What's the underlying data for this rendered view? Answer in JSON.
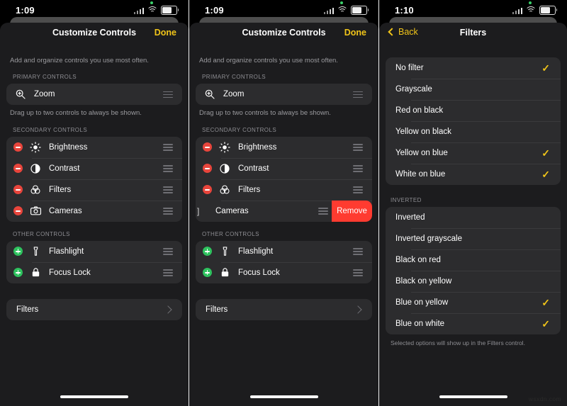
{
  "watermark": "wsxdn.com",
  "panels": [
    {
      "id": "customize-controls",
      "status": {
        "time": "1:09"
      },
      "nav": {
        "title": "Customize Controls",
        "done": "Done"
      },
      "hint_top": "Add and organize controls you use most often.",
      "hint_primary": "Drag up to two controls to always be shown.",
      "sections": [
        {
          "header": "PRIMARY CONTROLS",
          "rows": [
            {
              "label": "Zoom",
              "icon": "zoom-in-icon",
              "badge": "none",
              "handle": true
            }
          ]
        },
        {
          "header": "SECONDARY CONTROLS",
          "rows": [
            {
              "label": "Brightness",
              "icon": "brightness-icon",
              "badge": "minus",
              "handle": true
            },
            {
              "label": "Contrast",
              "icon": "contrast-icon",
              "badge": "minus",
              "handle": true
            },
            {
              "label": "Filters",
              "icon": "filters-icon",
              "badge": "minus",
              "handle": true
            },
            {
              "label": "Cameras",
              "icon": "camera-icon",
              "badge": "minus",
              "handle": true
            }
          ]
        },
        {
          "header": "OTHER CONTROLS",
          "rows": [
            {
              "label": "Flashlight",
              "icon": "flashlight-icon",
              "badge": "plus",
              "handle": true
            },
            {
              "label": "Focus Lock",
              "icon": "lock-icon",
              "badge": "plus",
              "handle": true
            }
          ]
        }
      ],
      "filters_row": {
        "label": "Filters",
        "disclosure": "chevron-right-icon"
      }
    },
    {
      "id": "customize-controls-swiped",
      "status": {
        "time": "1:09"
      },
      "nav": {
        "title": "Customize Controls",
        "done": "Done"
      },
      "hint_top": "Add and organize controls you use most often.",
      "hint_primary": "Drag up to two controls to always be shown.",
      "sections": [
        {
          "header": "PRIMARY CONTROLS",
          "rows": [
            {
              "label": "Zoom",
              "icon": "zoom-in-icon",
              "badge": "none",
              "handle": true
            }
          ]
        },
        {
          "header": "SECONDARY CONTROLS",
          "rows": [
            {
              "label": "Brightness",
              "icon": "brightness-icon",
              "badge": "minus",
              "handle": true
            },
            {
              "label": "Contrast",
              "icon": "contrast-icon",
              "badge": "minus",
              "handle": true
            },
            {
              "label": "Filters",
              "icon": "filters-icon",
              "badge": "minus",
              "handle": true
            },
            {
              "label": "Cameras",
              "icon": "camera-icon",
              "badge": "swiped",
              "handle": true,
              "swiped": true,
              "remove_label": "Remove"
            }
          ]
        },
        {
          "header": "OTHER CONTROLS",
          "rows": [
            {
              "label": "Flashlight",
              "icon": "flashlight-icon",
              "badge": "plus",
              "handle": true
            },
            {
              "label": "Focus Lock",
              "icon": "lock-icon",
              "badge": "plus",
              "handle": true
            }
          ]
        }
      ],
      "filters_row": {
        "label": "Filters",
        "disclosure": "chevron-right-icon"
      }
    },
    {
      "id": "filters",
      "status": {
        "time": "1:10"
      },
      "nav": {
        "back": "Back",
        "title": "Filters"
      },
      "groups": [
        {
          "header": "",
          "items": [
            {
              "label": "No filter",
              "checked": true
            },
            {
              "label": "Grayscale",
              "checked": false
            },
            {
              "label": "Red on black",
              "checked": false
            },
            {
              "label": "Yellow on black",
              "checked": false
            },
            {
              "label": "Yellow on blue",
              "checked": true
            },
            {
              "label": "White on blue",
              "checked": true
            }
          ]
        },
        {
          "header": "INVERTED",
          "items": [
            {
              "label": "Inverted",
              "checked": false
            },
            {
              "label": "Inverted grayscale",
              "checked": false
            },
            {
              "label": "Black on red",
              "checked": false
            },
            {
              "label": "Black on yellow",
              "checked": false
            },
            {
              "label": "Blue on yellow",
              "checked": true
            },
            {
              "label": "Blue on white",
              "checked": true
            }
          ]
        }
      ],
      "footnote": "Selected options will show up in the Filters control."
    }
  ],
  "colors": {
    "accent_yellow": "#f0c419",
    "destructive_red": "#ff3b30",
    "badge_minus": "#e8453c",
    "badge_plus": "#2ec25e",
    "card": "#2c2c2e",
    "sheet": "#1c1c1e"
  }
}
